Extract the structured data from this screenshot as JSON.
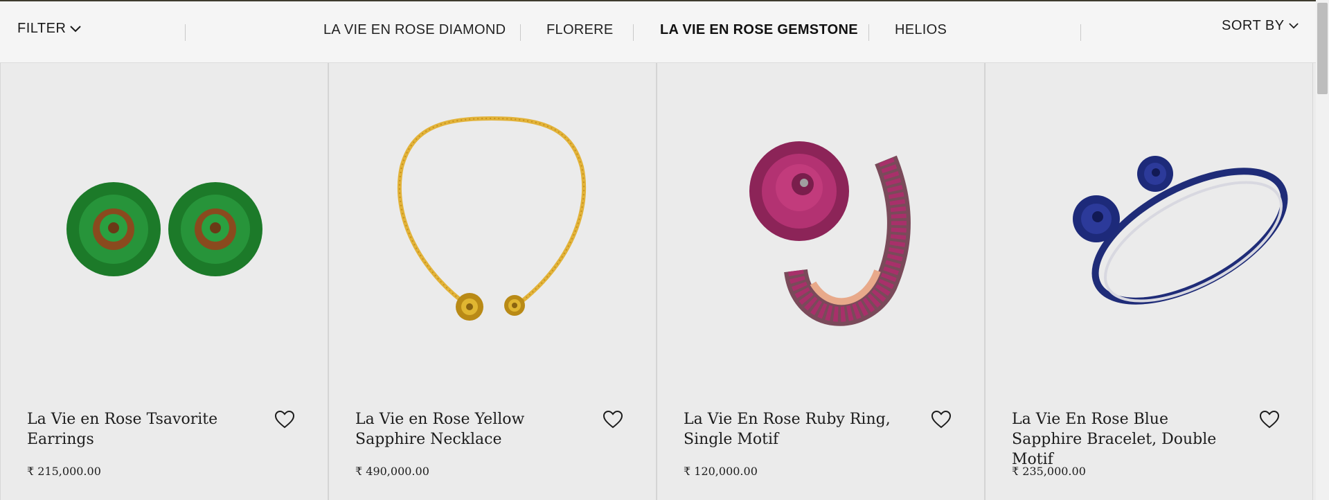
{
  "filter_bar": {
    "filter_label": "FILTER",
    "sort_label": "SORT BY",
    "collections": [
      {
        "label": "LA VIE EN ROSE DIAMOND",
        "active": false
      },
      {
        "label": "FLORERE",
        "active": false
      },
      {
        "label": "LA VIE EN ROSE GEMSTONE",
        "active": true
      },
      {
        "label": "HELIOS",
        "active": false
      }
    ]
  },
  "products": [
    {
      "name": "La Vie en Rose Tsavorite Earrings",
      "price": "₹ 215,000.00",
      "image": "green-tsavorite-rose-earrings"
    },
    {
      "name": "La Vie en Rose Yellow Sapphire Necklace",
      "price": "₹ 490,000.00",
      "image": "yellow-gold-rose-necklace"
    },
    {
      "name": "La Vie En Rose Ruby Ring, Single Motif",
      "price": "₹ 120,000.00",
      "image": "ruby-rose-wrap-ring"
    },
    {
      "name": "La Vie En Rose Blue Sapphire Bracelet, Double Motif",
      "price": "₹ 235,000.00",
      "image": "blue-sapphire-rose-cuff-bracelet"
    }
  ],
  "icons": {
    "wishlist": "heart-outline-icon",
    "dropdown": "chevron-down-icon"
  },
  "colors": {
    "tsavorite": "#1f8a2c",
    "gold": "#e2b33a",
    "ruby": "#b0306a",
    "sapphire": "#23307d"
  }
}
